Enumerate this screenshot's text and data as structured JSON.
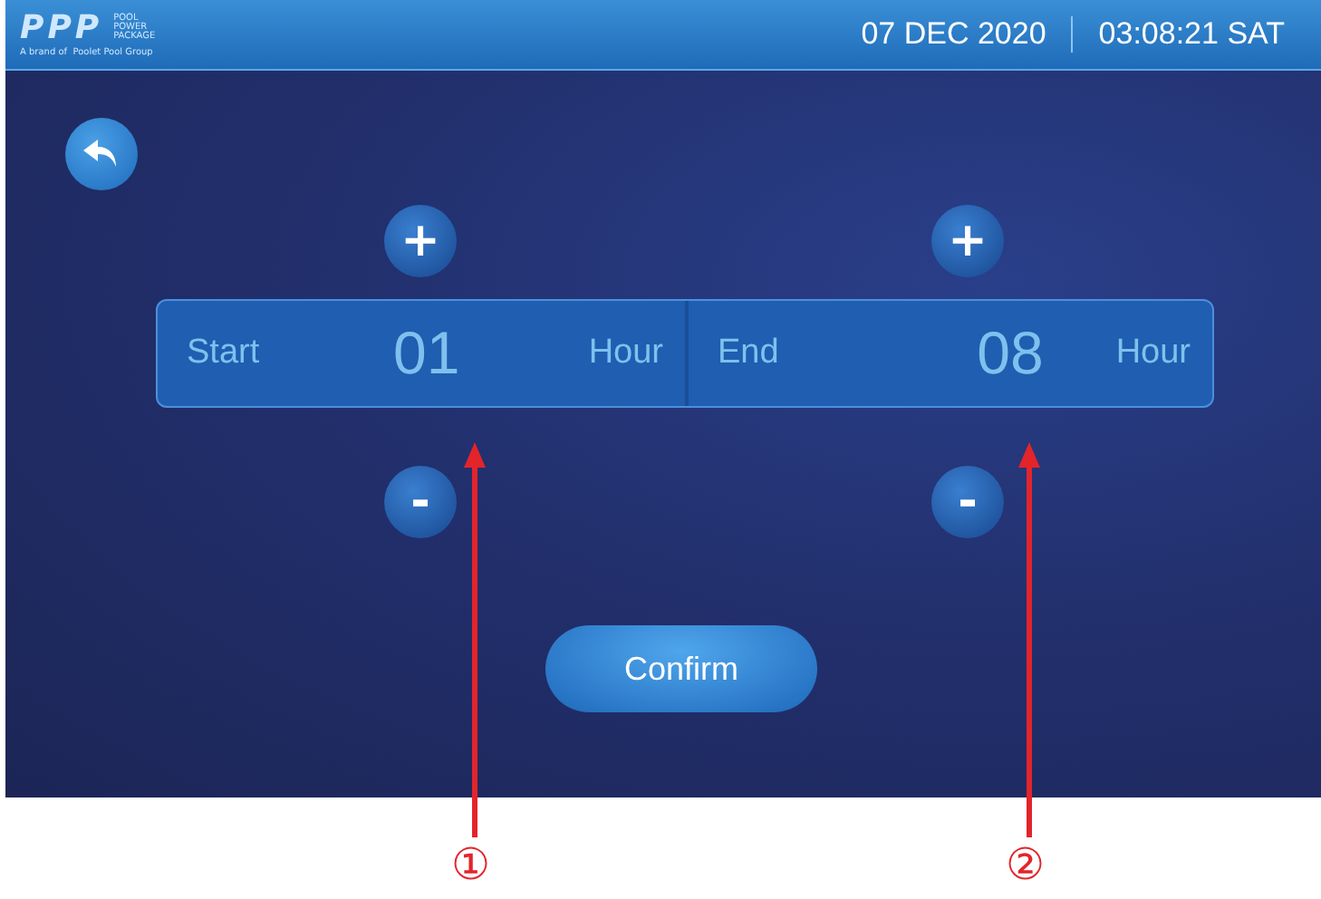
{
  "header": {
    "logo": {
      "mark": "PPP",
      "name_lines": [
        "POOL",
        "POWER",
        "PACKAGE"
      ],
      "tagline": "A brand of  Poolet Pool Group"
    },
    "date": "07 DEC 2020",
    "time": "03:08:21 SAT"
  },
  "timer": [
    {
      "label": "Start",
      "value": "01",
      "unit": "Hour",
      "plus": "+",
      "minus": "-"
    },
    {
      "label": "End",
      "value": "08",
      "unit": "Hour",
      "plus": "+",
      "minus": "-"
    }
  ],
  "confirm": "Confirm",
  "callouts": [
    {
      "number": "①"
    },
    {
      "number": "②"
    }
  ]
}
